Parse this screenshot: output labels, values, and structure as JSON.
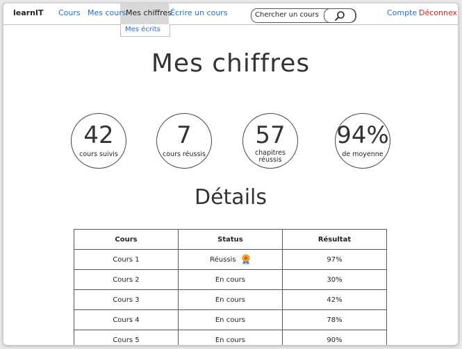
{
  "nav": {
    "brand": "learnIT",
    "items": [
      {
        "label": "Cours"
      },
      {
        "label": "Mes cours"
      },
      {
        "label": "Mes chiffres"
      },
      {
        "label": "Écrire un cours"
      }
    ],
    "dropdown_item": "Mes écrits",
    "search_placeholder": "Chercher un cours",
    "account": "Compte",
    "logout": "Déconnexion"
  },
  "page_title": "Mes chiffres",
  "stats": [
    {
      "value": "42",
      "label": "cours suivis"
    },
    {
      "value": "7",
      "label": "cours réussis"
    },
    {
      "value": "57",
      "label": "chapitres réussis"
    },
    {
      "value": "94%",
      "label": "de moyenne"
    }
  ],
  "details_title": "Détails",
  "table": {
    "headers": [
      "Cours",
      "Status",
      "Résultat"
    ],
    "rows": [
      {
        "course": "Cours 1",
        "status": "Réussis",
        "result": "97%"
      },
      {
        "course": "Cours 2",
        "status": "En cours",
        "result": "30%"
      },
      {
        "course": "Cours 3",
        "status": "En cours",
        "result": "42%"
      },
      {
        "course": "Cours 4",
        "status": "En cours",
        "result": "78%"
      },
      {
        "course": "Cours 5",
        "status": "En cours",
        "result": "90%"
      }
    ]
  },
  "colors": {
    "link": "#1f6fc9",
    "logout": "#d62222",
    "active_tab": "#d8d8d8"
  }
}
